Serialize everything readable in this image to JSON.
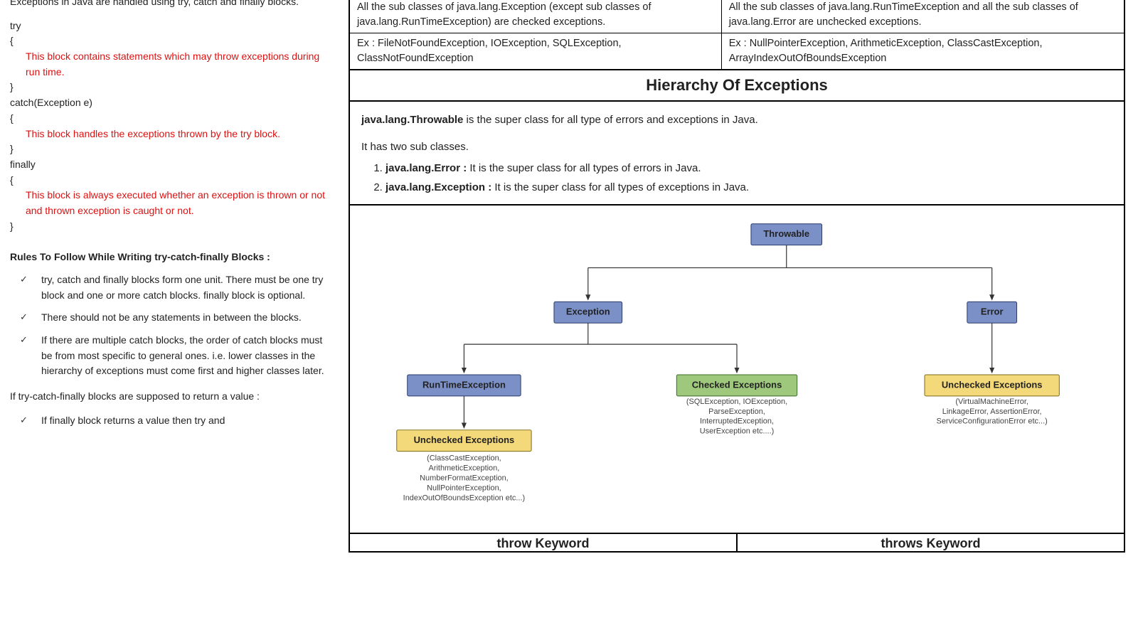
{
  "left": {
    "intro": "Exceptions in Java are handled using try, catch and finally blocks.",
    "try_kw": "try",
    "brace_open": "{",
    "brace_close": "}",
    "try_comment": "This block contains statements which may throw exceptions during run time.",
    "catch_kw": "catch(Exception e)",
    "catch_comment": "This block handles the exceptions thrown by the try block.",
    "finally_kw": "finally",
    "finally_comment": "This block is always executed whether an exception is thrown or not and thrown exception is caught or not.",
    "rules_heading": "Rules To Follow While Writing try-catch-finally Blocks :",
    "rules": [
      "try, catch and finally blocks form one unit. There must be one try block and one or more catch blocks. finally block is optional.",
      "There should not be any statements in between the blocks.",
      "If there are multiple catch blocks, the order of catch blocks must be from most specific to general ones. i.e. lower classes in the hierarchy of exceptions must come first and higher classes later."
    ],
    "return_intro": "If try-catch-finally blocks are supposed to return a value :",
    "return_rule_partial": "If finally block returns a value then try and"
  },
  "table": {
    "r1l": "All the sub classes of java.lang.Exception (except sub classes of java.lang.RunTimeException) are checked exceptions.",
    "r1r": "All the sub classes of java.lang.RunTimeException and all the sub classes of java.lang.Error are unchecked exceptions.",
    "r2l": "Ex : FileNotFoundException, IOException, SQLException, ClassNotFoundException",
    "r2r": "Ex : NullPointerException, ArithmeticException, ClassCastException, ArrayIndexOutOfBoundsException"
  },
  "hier": {
    "title": "Hierarchy Of Exceptions",
    "lead_b": "java.lang.Throwable",
    "lead_rest": " is the super class for all type of errors and exceptions in Java.",
    "subline": "It has two sub classes.",
    "item1_b": "java.lang.Error :",
    "item1_rest": " It is the super class for all types of errors in Java.",
    "item2_b": "java.lang.Exception :",
    "item2_rest": " It is the super class for all types of exceptions in Java."
  },
  "diagram": {
    "throwable": "Throwable",
    "exception": "Exception",
    "error": "Error",
    "runtime": "RunTimeException",
    "checked": "Checked Exceptions",
    "unchecked1": "Unchecked Exceptions",
    "unchecked2": "Unchecked Exceptions",
    "ann_checked": [
      "(SQLException, IOException,",
      "ParseException,",
      "InterruptedException,",
      "UserException etc....)"
    ],
    "ann_unchecked1": [
      "(ClassCastException,",
      "ArithmeticException,",
      "NumberFormatException,",
      "NullPointerException,",
      "IndexOutOfBoundsException etc...)"
    ],
    "ann_unchecked2": [
      "(VirtualMachineError,",
      "LinkageError, AssertionError,",
      "ServiceConfigurationError etc...)"
    ]
  },
  "bottom": {
    "left": "throw Keyword",
    "right": "throws Keyword"
  }
}
